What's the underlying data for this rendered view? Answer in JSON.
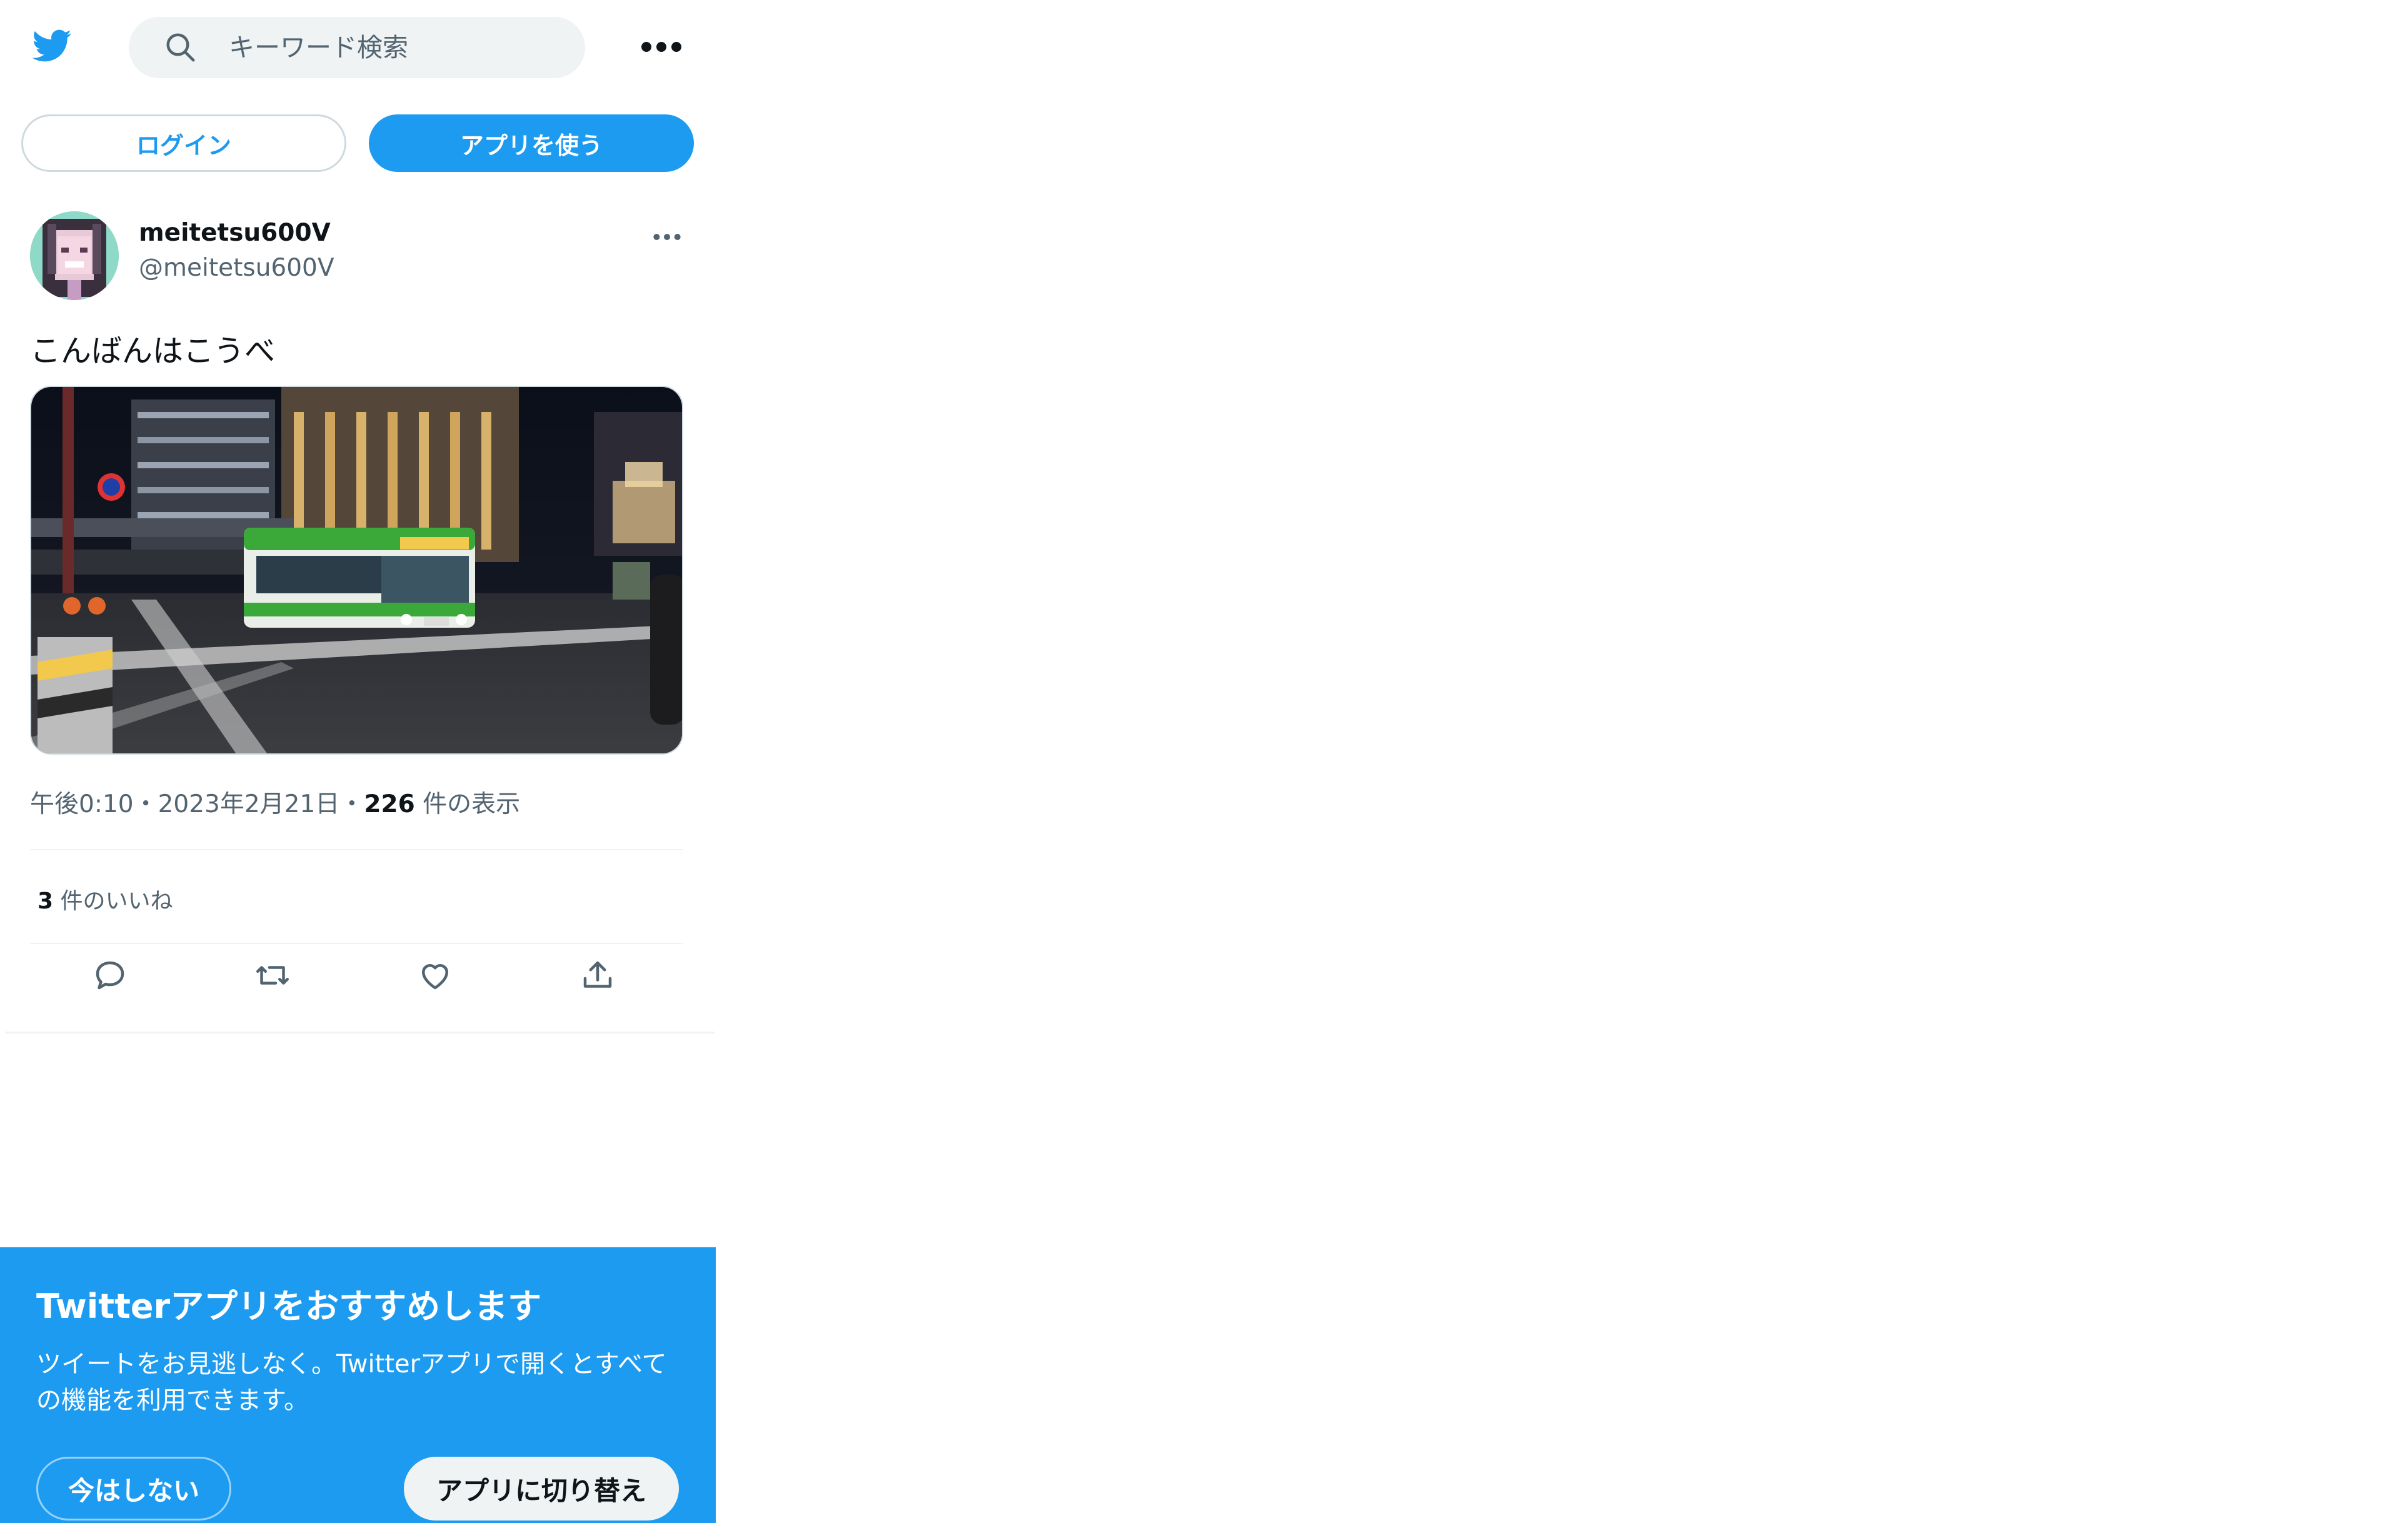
{
  "header": {
    "search_placeholder": "キーワード検索",
    "logo_icon": "twitter-bird-icon",
    "more_icon": "more-horizontal-icon"
  },
  "auth": {
    "login_label": "ログイン",
    "use_app_label": "アプリを使う"
  },
  "tweet": {
    "display_name": "meitetsu600V",
    "handle": "@meitetsu600V",
    "text": "こんばんはこうべ",
    "time": "午後0:10",
    "sep1": "・",
    "date": "2023年2月21日",
    "sep2": "・",
    "views_count": "226",
    "views_label": " 件の表示",
    "likes_count": "3",
    "likes_label": " 件のいいね",
    "actions": [
      "reply-icon",
      "retweet-icon",
      "like-icon",
      "share-icon"
    ]
  },
  "promo": {
    "title": "Twitterアプリをおすすめします",
    "body": "ツイートをお見逃しなく。Twitterアプリで開くとすべての機能を利用できます。",
    "later_label": "今はしない",
    "switch_label": "アプリに切り替え"
  },
  "colors": {
    "brand": "#1d9bf0",
    "text_primary": "#0f1419",
    "text_secondary": "#536471"
  }
}
